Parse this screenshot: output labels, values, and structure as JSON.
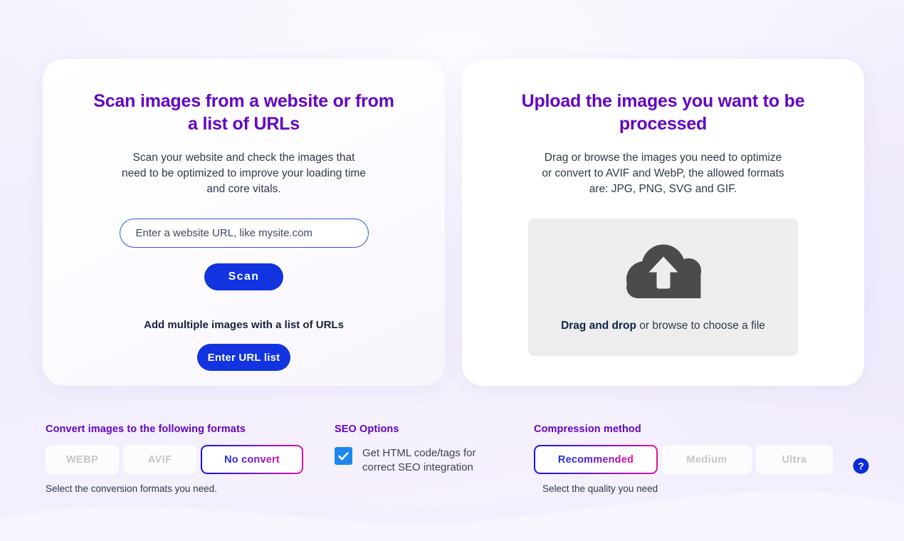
{
  "theme": {
    "background": "#f6f3fd",
    "heading_purple": "#6305c4",
    "primary_blue": "#1133e0",
    "gradient_start": "#1a16e0",
    "gradient_end": "#e2129c",
    "checkbox_blue": "#1e87ee",
    "muted_gray": "#c6c6c8",
    "body_text": "#2e3a4d"
  },
  "scan_card": {
    "title": "Scan images from a website or from a list of URLs",
    "description": "Scan your website and check the images that need to be optimized to improve your loading time and core vitals.",
    "url_input": {
      "value": "",
      "placeholder": "Enter a website URL, like mysite.com"
    },
    "scan_button": "Scan",
    "multiple_label": "Add multiple images with a list of URLs",
    "url_list_button": "Enter URL list"
  },
  "upload_card": {
    "title": "Upload the images you want to be processed",
    "description": "Drag or browse the images you need to optimize or convert to AVIF and WebP, the allowed formats are: JPG, PNG, SVG and GIF.",
    "dropzone": {
      "icon": "cloud-upload-icon",
      "text_bold": "Drag and drop",
      "text_rest": " or browse to choose a file"
    }
  },
  "options": {
    "convert": {
      "heading": "Convert images to the following formats",
      "buttons": [
        {
          "label": "WEBP",
          "selected": false
        },
        {
          "label": "AVIF",
          "selected": false
        },
        {
          "label": "No convert",
          "selected": true
        }
      ],
      "hint": "Select the conversion formats you need."
    },
    "seo": {
      "heading": "SEO Options",
      "checkbox": {
        "checked": true,
        "label": "Get HTML code/tags for correct SEO integration"
      }
    },
    "compression": {
      "heading": "Compression method",
      "buttons": [
        {
          "label": "Recommended",
          "selected": true
        },
        {
          "label": "Medium",
          "selected": false
        },
        {
          "label": "Ultra",
          "selected": false
        }
      ],
      "hint": "Select the quality you need",
      "help_icon": "help-circle-icon"
    }
  }
}
